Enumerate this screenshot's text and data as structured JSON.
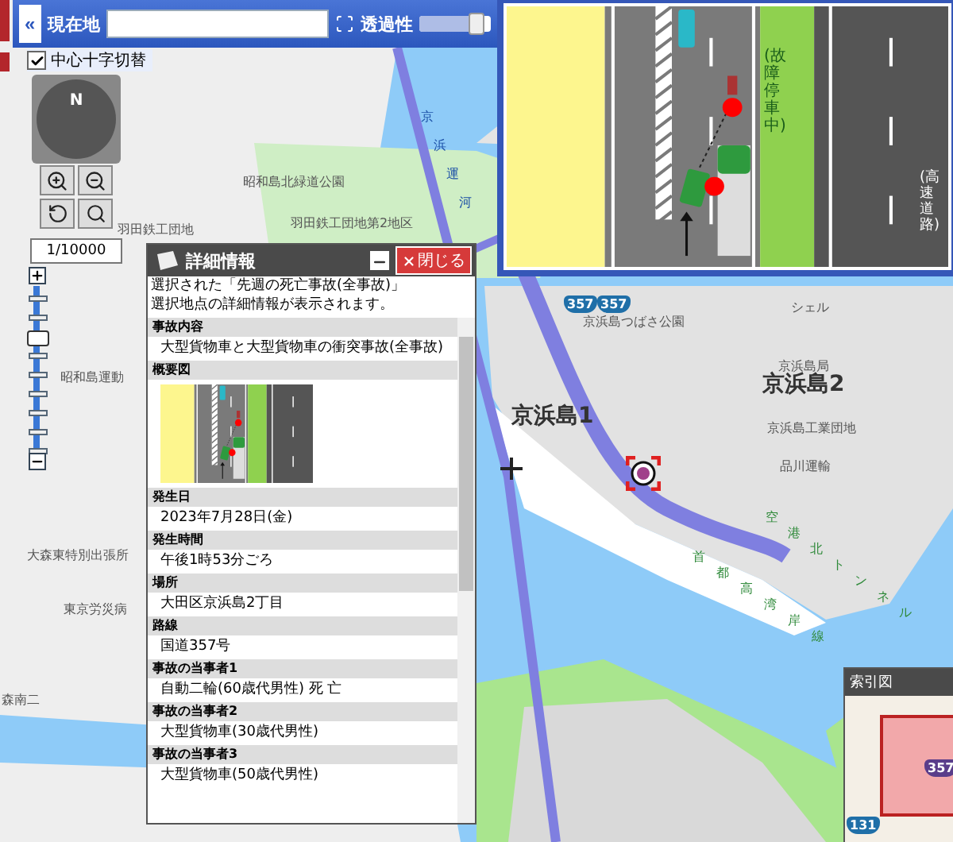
{
  "toolbar": {
    "collapse": "«",
    "location_label": "現在地",
    "transparency_label": "透過性",
    "transparency_slider": {
      "level": 0.85
    }
  },
  "center_cross_toggle": {
    "label": "中心十字切替",
    "checked": true
  },
  "compass": {
    "north": "N"
  },
  "scale": "1/10000",
  "zoom_slider": {
    "level": 0.72
  },
  "accident_diagram": {
    "labels": [
      "(故障停車中)",
      "(高速道路)"
    ]
  },
  "detail_panel": {
    "title": "詳細情報",
    "close_label": "閉じる",
    "intro": [
      "選択された「先週の死亡事故(全事故)」",
      "選択地点の詳細情報が表示されます。"
    ],
    "sections": [
      {
        "label": "事故内容",
        "kind": "text",
        "value": "大型貨物車と大型貨物車の衝突事故(全事故)"
      },
      {
        "label": "概要図",
        "kind": "diagram"
      },
      {
        "label": "発生日",
        "kind": "text",
        "value": "2023年7月28日(金)"
      },
      {
        "label": "発生時間",
        "kind": "text",
        "value": "午後1時53分ごろ"
      },
      {
        "label": "場所",
        "kind": "text",
        "value": "大田区京浜島2丁目"
      },
      {
        "label": "路線",
        "kind": "text",
        "value": "国道357号"
      },
      {
        "label": "事故の当事者1",
        "kind": "text",
        "value": "自動二輪(60歳代男性) 死 亡"
      },
      {
        "label": "事故の当事者2",
        "kind": "text",
        "value": "大型貨物車(30歳代男性)"
      },
      {
        "label": "事故の当事者3",
        "kind": "text",
        "value": "大型貨物車(50歳代男性)"
      }
    ]
  },
  "map_labels": [
    {
      "text": "昭和島北緑道公園",
      "kind": "place"
    },
    {
      "text": "羽田鉄工団地",
      "kind": "place"
    },
    {
      "text": "羽田鉄工団地第2地区",
      "kind": "place"
    },
    {
      "text": "昭和島運動",
      "kind": "place"
    },
    {
      "text": "京浜島つばさ公園",
      "kind": "place"
    },
    {
      "text": "シェル",
      "kind": "place"
    },
    {
      "text": "京浜島局",
      "kind": "place"
    },
    {
      "text": "京浜島2",
      "kind": "district"
    },
    {
      "text": "京浜島1",
      "kind": "district"
    },
    {
      "text": "京浜島工業団地",
      "kind": "place"
    },
    {
      "text": "品川運輸",
      "kind": "place"
    },
    {
      "text": "大森東特別出張所",
      "kind": "place"
    },
    {
      "text": "東京労災病",
      "kind": "place"
    },
    {
      "text": "森南二",
      "kind": "place"
    },
    {
      "chars": [
        "京",
        "浜",
        "運",
        "河"
      ],
      "kind": "water"
    },
    {
      "chars": [
        "首",
        "都",
        "高",
        "湾",
        "岸",
        "線"
      ],
      "kind": "road"
    },
    {
      "chars": [
        "空",
        "港",
        "北",
        "ト",
        "ン",
        "ネ",
        "ル"
      ],
      "kind": "tunnel"
    }
  ],
  "route_shields": [
    "357",
    "357"
  ],
  "index_map": {
    "title": "索引図",
    "shields": [
      "357",
      "131"
    ]
  }
}
